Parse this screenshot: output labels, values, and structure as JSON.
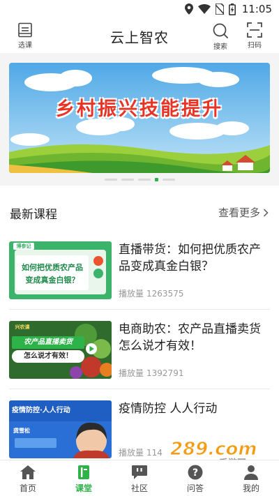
{
  "status_bar": {
    "time": "11:05",
    "icons": [
      "location-icon",
      "wifi-icon",
      "no-sim-icon",
      "battery-charging-icon"
    ]
  },
  "header": {
    "title": "云上智农",
    "left_button": {
      "label": "选课",
      "icon": "book-icon"
    },
    "search_button": {
      "label": "搜索",
      "icon": "search-icon"
    },
    "scan_button": {
      "label": "扫码",
      "icon": "scan-icon"
    }
  },
  "banner": {
    "title": "乡村振兴技能提升",
    "slide_count": 5,
    "active_slide": 4
  },
  "latest_courses": {
    "title": "最新课程",
    "more_label": "查看更多",
    "plays_label": "播放量",
    "items": [
      {
        "title": "直播带货：如何把优质农产品变成真金白银？",
        "plays": "1263575",
        "thumb_tag": "博参记",
        "thumb_text": [
          "如何把优质农产品",
          "变成真金白银？"
        ]
      },
      {
        "title": "电商助农：农产品直播卖货怎么说才有效！",
        "plays": "1392791",
        "thumb_tag": "兴农课",
        "thumb_text": [
          "农产品直播卖货",
          "怎么说才有效！"
        ]
      },
      {
        "title": "疫情防控 人人行动",
        "plays": "114",
        "thumb_text": [
          "疫情防控·人人行动",
          "龚雪松"
        ]
      }
    ]
  },
  "watermark": {
    "text": "289.com",
    "sub": "手游网"
  },
  "bottom_nav": {
    "active": "课堂",
    "items": [
      {
        "label": "首页",
        "icon": "home-icon"
      },
      {
        "label": "课堂",
        "icon": "classroom-icon"
      },
      {
        "label": "社区",
        "icon": "chat-bubble-icon"
      },
      {
        "label": "问答",
        "icon": "question-icon"
      },
      {
        "label": "我的",
        "icon": "person-icon"
      }
    ]
  },
  "colors": {
    "accent": "#2db34a",
    "banner_title": "#e83325"
  }
}
